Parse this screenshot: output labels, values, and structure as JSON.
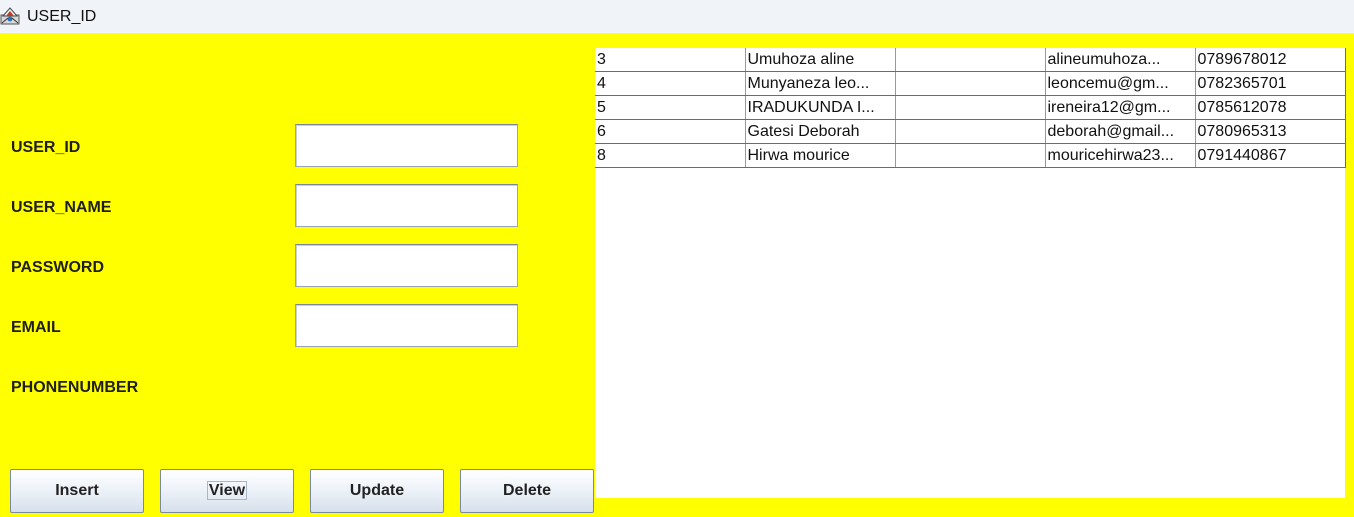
{
  "window": {
    "title": "USER_ID"
  },
  "form": {
    "labels": {
      "user_id": "USER_ID",
      "user_name": "USER_NAME",
      "password": "PASSWORD",
      "email": "EMAIL",
      "phonenumber": "PHONENUMBER"
    },
    "values": {
      "user_id": "",
      "user_name": "",
      "password": "",
      "email": ""
    }
  },
  "buttons": {
    "insert": "Insert",
    "view": "View",
    "update": "Update",
    "delete": "Delete"
  },
  "table": {
    "rows": [
      [
        "3",
        "Umuhoza aline",
        "",
        "alineumuhoza...",
        "0789678012"
      ],
      [
        "4",
        "Munyaneza leo...",
        "",
        "leoncemu@gm...",
        "0782365701"
      ],
      [
        "5",
        "IRADUKUNDA I...",
        "",
        "ireneira12@gm...",
        "0785612078"
      ],
      [
        "6",
        "Gatesi Deborah",
        "",
        "deborah@gmail...",
        "0780965313"
      ],
      [
        "8",
        "Hirwa mourice",
        "",
        "mouricehirwa23...",
        "0791440867"
      ]
    ]
  },
  "colors": {
    "background": "#ffff00",
    "titlebar": "#f0f3f7",
    "table_background": "#ffffff"
  },
  "icons": {
    "app": "java-app-icon"
  }
}
